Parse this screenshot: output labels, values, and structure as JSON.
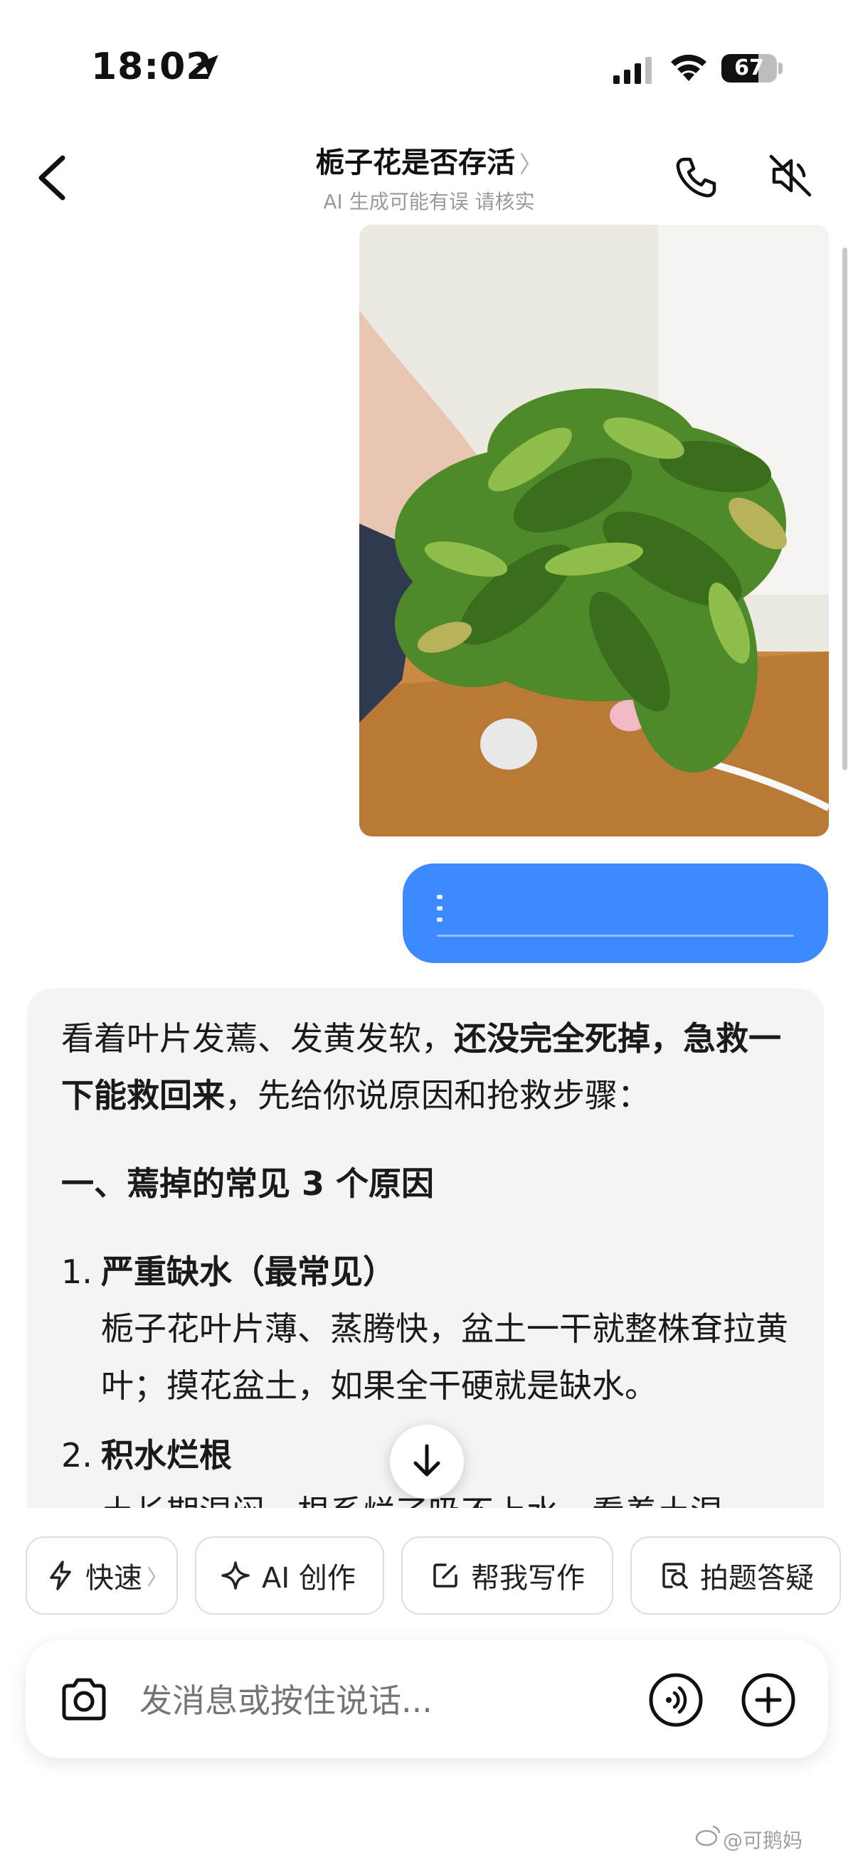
{
  "status_bar": {
    "time": "18:02",
    "battery": "67",
    "battery_level": 0.67
  },
  "header": {
    "title": "栀子花是否存活",
    "title_chevron": "〉",
    "subtitle": "AI 生成可能有误 请核实"
  },
  "ai_message": {
    "intro_part1": "看着叶片发蔫、发黄发软，",
    "intro_bold": "还没完全死掉，急救一下能救回来",
    "intro_part2": "，先给你说原因和抢救步骤：",
    "section_heading": "一、蔫掉的常见 3 个原因",
    "items": [
      {
        "num": "1.",
        "title": "严重缺水（最常见）",
        "body": "栀子花叶片薄、蒸腾快，盆土一干就整株耷拉黄叶；摸花盆土，如果全干硬就是缺水。"
      },
      {
        "num": "2.",
        "title": "积水烂根",
        "body": "土长期湿闷，根系烂了吸不上水，看着土湿"
      }
    ]
  },
  "chips": [
    {
      "label": "快速",
      "chevron": "〉",
      "icon": "lightning-icon"
    },
    {
      "label": "AI 创作",
      "icon": "sparkle-icon"
    },
    {
      "label": "帮我写作",
      "icon": "edit-icon"
    },
    {
      "label": "拍题答疑",
      "icon": "search-doc-icon"
    }
  ],
  "input": {
    "placeholder": "发消息或按住说话..."
  },
  "watermark": "@可鹅妈",
  "colors": {
    "user_bubble": "#3d89ff",
    "ai_card": "#f4f4f6",
    "leaf_green": "#4f8a2a"
  }
}
